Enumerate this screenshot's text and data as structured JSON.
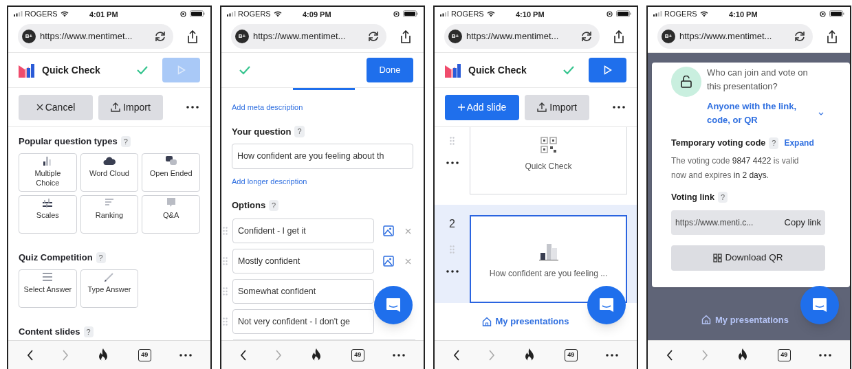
{
  "phones": [
    {
      "status_bar": {
        "carrier": "ROGERS",
        "time": "4:01 PM"
      },
      "address_bar": {
        "badge": "B+",
        "url": "https://www.mentimet..."
      },
      "header": {
        "kind": "presentation",
        "title": "Quick Check",
        "saved": true,
        "present_disabled": true
      },
      "screen": {
        "kind": "question_types",
        "toolbar": [
          {
            "kind": "cancel",
            "label": "Cancel"
          },
          {
            "kind": "import",
            "label": "Import"
          }
        ],
        "sections": [
          {
            "title": "Popular question types",
            "help": "?",
            "tiles": [
              {
                "kind": "bars",
                "label": "Multiple Choice"
              },
              {
                "kind": "cloud",
                "label": "Word Cloud"
              },
              {
                "kind": "bubbles",
                "label": "Open Ended"
              },
              {
                "kind": "scales",
                "label": "Scales"
              },
              {
                "kind": "ranking",
                "label": "Ranking"
              },
              {
                "kind": "speech",
                "label": "Q&A"
              }
            ]
          },
          {
            "title": "Quiz Competition",
            "help": "?",
            "tiles": [
              {
                "kind": "lines",
                "label": "Select Answer"
              },
              {
                "kind": "pencil",
                "label": "Type Answer"
              }
            ]
          },
          {
            "title": "Content slides",
            "help": "?"
          }
        ]
      },
      "bottom_bar": {
        "tab_count": "49"
      }
    },
    {
      "status_bar": {
        "carrier": "ROGERS",
        "time": "4:09 PM"
      },
      "address_bar": {
        "badge": "B+",
        "url": "https://www.mentimet..."
      },
      "header": {
        "kind": "editor",
        "saved": true,
        "action": "Done"
      },
      "screen": {
        "kind": "question_editor",
        "meta_link": "Add meta description",
        "question": {
          "label": "Your question",
          "help": "?",
          "value": "How confident are you feeling about th"
        },
        "description_link": "Add longer description",
        "options": {
          "label": "Options",
          "help": "?",
          "items": [
            {
              "value": "Confident - I get it",
              "tools": true
            },
            {
              "value": "Mostly confident",
              "tools": true
            },
            {
              "value": "Somewhat confident"
            },
            {
              "value": "Not very confident - I don't ge"
            }
          ]
        }
      },
      "chat_button": true,
      "bottom_bar": {
        "tab_count": "49"
      }
    },
    {
      "status_bar": {
        "carrier": "ROGERS",
        "time": "4:10 PM"
      },
      "address_bar": {
        "badge": "B+",
        "url": "https://www.mentimet..."
      },
      "header": {
        "kind": "presentation",
        "title": "Quick Check",
        "saved": true,
        "present_disabled": false
      },
      "screen": {
        "kind": "slide_list",
        "toolbar": [
          {
            "kind": "add",
            "label": "Add slide"
          },
          {
            "kind": "import",
            "label": "Import"
          }
        ],
        "slides": [
          {
            "kind": "qr",
            "title": "Quick Check",
            "selected": false
          },
          {
            "number": "2",
            "kind": "bars",
            "title": "How confident are you feeling ...",
            "selected": true
          }
        ],
        "footer_link": "My presentations"
      },
      "chat_button": true,
      "bottom_bar": {
        "tab_count": "49"
      }
    },
    {
      "status_bar": {
        "carrier": "ROGERS",
        "time": "4:10 PM"
      },
      "address_bar": {
        "badge": "B+",
        "url": "https://www.mentimet..."
      },
      "screen": {
        "kind": "share_popup",
        "access": {
          "question": "Who can join and vote on this presentation?",
          "value": "Anyone with the link, code, or QR"
        },
        "voting_code": {
          "title": "Temporary voting code",
          "help": "?",
          "action": "Expand",
          "text": "The voting code **9847 4422** is valid now and expires **in 2 days**."
        },
        "voting_link": {
          "title": "Voting link",
          "help": "?",
          "url": "https://www.menti.c...",
          "action": "Copy link"
        },
        "download": "Download QR",
        "background_link": "My presentations"
      },
      "chat_button": true,
      "bottom_bar": {
        "tab_count": "49"
      }
    }
  ]
}
